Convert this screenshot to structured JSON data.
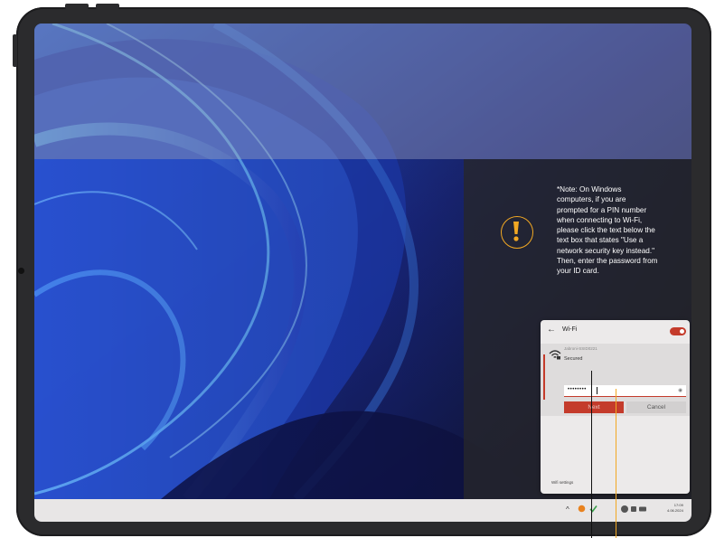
{
  "note": {
    "text": "*Note: On Windows\ncomputers, if you are\nprompted for a PIN number\nwhen connecting to Wi-Fi,\nplease click the text below the\ntext box that states \"Use a\nnetwork security key instead.\"\nThen, enter the password from\nyour ID card."
  },
  "icons": {
    "warning": "warning-icon",
    "back": "back-arrow-icon",
    "wifi": "wifi-icon",
    "eye": "eye-icon"
  },
  "wifi_panel": {
    "back_arrow": "←",
    "title": "Wi-Fi",
    "toggle_on": true,
    "network_name": "Jabroni-SSID0221",
    "status": "Secured",
    "password_value": "••••••••",
    "eye_glyph": "◉",
    "next_label": "Next",
    "cancel_label": "Cancel",
    "settings_label": "Wifi settings"
  },
  "taskbar": {
    "chevron": "^",
    "time": "17:09",
    "date": "4.06.2024"
  },
  "colors": {
    "accent": "#c43b2b",
    "warning": "#f2a823",
    "bezel": "#2b2b2d"
  }
}
